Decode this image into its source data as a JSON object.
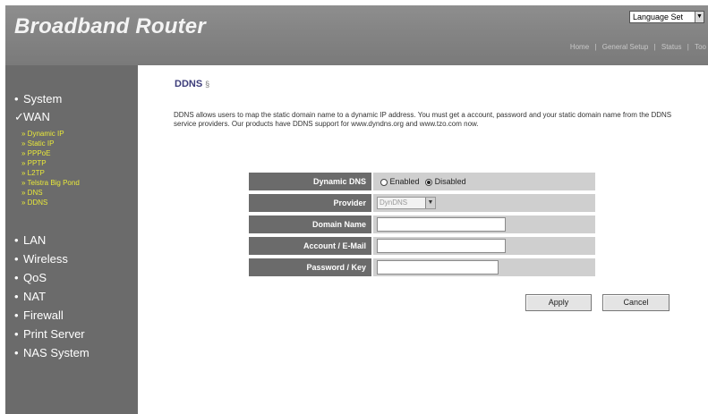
{
  "header": {
    "brand": "Broadband Router",
    "language_label": "Language Set",
    "topnav": [
      "Home",
      "General Setup",
      "Status",
      "Too"
    ]
  },
  "sidebar": {
    "items": [
      {
        "label": "System",
        "bullet": "•"
      },
      {
        "label": "WAN",
        "bullet": "✓"
      },
      {
        "label": "LAN",
        "bullet": "•"
      },
      {
        "label": "Wireless",
        "bullet": "•"
      },
      {
        "label": "QoS",
        "bullet": "•"
      },
      {
        "label": "NAT",
        "bullet": "•"
      },
      {
        "label": "Firewall",
        "bullet": "•"
      },
      {
        "label": "Print Server",
        "bullet": "•"
      },
      {
        "label": "NAS System",
        "bullet": "•"
      }
    ],
    "wan_sub": [
      "» Dynamic IP",
      "» Static IP",
      "» PPPoE",
      "» PPTP",
      "» L2TP",
      "» Telstra Big Pond",
      "» DNS",
      "» DDNS"
    ]
  },
  "content": {
    "title": "DDNS",
    "help": "§",
    "description": "DDNS allows users to map the static domain name to a dynamic IP address. You must get a account, password and your static domain name from the DDNS service providers. Our products have DDNS support for www.dyndns.org and www.tzo.com now.",
    "form": {
      "dynamic_dns_label": "Dynamic DNS",
      "enabled_label": "Enabled",
      "disabled_label": "Disabled",
      "selected": "Disabled",
      "provider_label": "Provider",
      "provider_value": "DynDNS",
      "domain_label": "Domain Name",
      "domain_value": "",
      "account_label": "Account / E-Mail",
      "account_value": "",
      "password_label": "Password / Key",
      "password_value": ""
    },
    "buttons": {
      "apply": "Apply",
      "cancel": "Cancel"
    }
  }
}
